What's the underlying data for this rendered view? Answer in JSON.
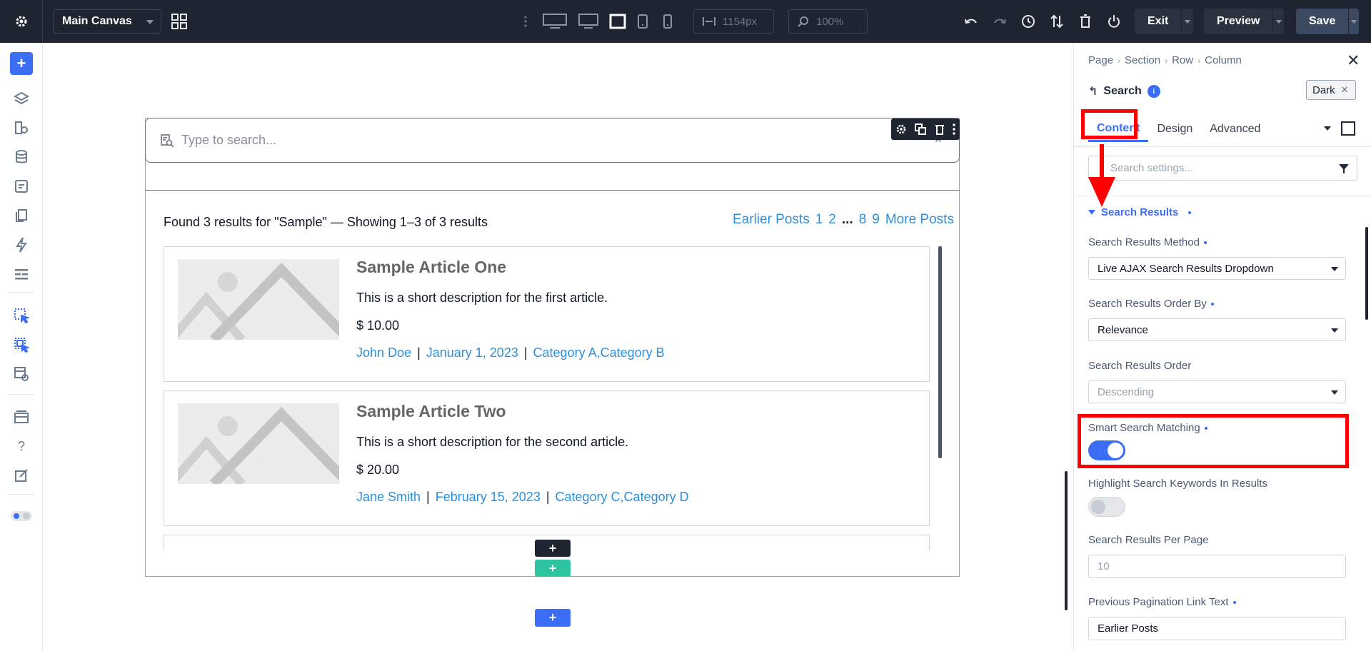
{
  "topbar": {
    "canvas_name": "Main Canvas",
    "width_value": "1154px",
    "zoom_value": "100%",
    "exit_label": "Exit",
    "preview_label": "Preview",
    "save_label": "Save"
  },
  "canvas": {
    "search_placeholder": "Type to search...",
    "results_summary": "Found 3 results for \"Sample\" — Showing 1–3 of 3 results",
    "pagination": {
      "prev": "Earlier Posts",
      "p1": "1",
      "p2": "2",
      "dots": "...",
      "p8": "8",
      "p9": "9",
      "next": "More Posts"
    },
    "articles": [
      {
        "title": "Sample Article One",
        "description": "This is a short description for the first article.",
        "price": "$ 10.00",
        "author": "John Doe",
        "date": "January 1, 2023",
        "categories": "Category A,Category B"
      },
      {
        "title": "Sample Article Two",
        "description": "This is a short description for the second article.",
        "price": "$ 20.00",
        "author": "Jane Smith",
        "date": "February 15, 2023",
        "categories": "Category C,Category D"
      }
    ],
    "meta_separator": "|"
  },
  "panel": {
    "breadcrumbs": [
      "Page",
      "Section",
      "Row",
      "Column"
    ],
    "module_name": "Search",
    "theme_chip": "Dark",
    "tabs": [
      "Content",
      "Design",
      "Advanced"
    ],
    "search_placeholder": "Search settings...",
    "group_title": "Search Results",
    "fields": {
      "method_label": "Search Results Method",
      "method_value": "Live AJAX Search Results Dropdown",
      "orderby_label": "Search Results Order By",
      "orderby_value": "Relevance",
      "order_label": "Search Results Order",
      "order_value": "Descending",
      "smart_label": "Smart Search Matching",
      "smart_on": true,
      "highlight_label": "Highlight Search Keywords In Results",
      "highlight_on": false,
      "perpage_label": "Search Results Per Page",
      "perpage_placeholder": "10",
      "prevtext_label": "Previous Pagination Link Text",
      "prevtext_value": "Earlier Posts"
    }
  },
  "colors": {
    "topbar": "#1e2530",
    "accent": "#3b6ef5",
    "link": "#2e8fdc",
    "highlight": "#ff0000",
    "add_green": "#2ec4a0"
  }
}
